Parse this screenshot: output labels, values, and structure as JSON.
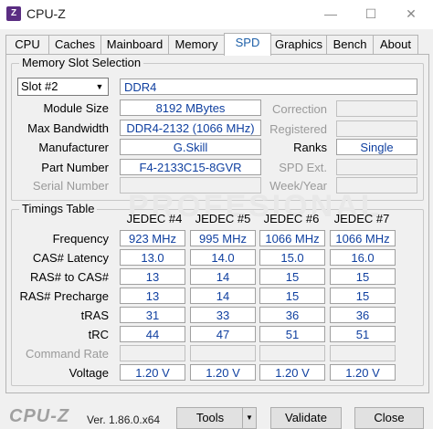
{
  "window": {
    "title": "CPU-Z",
    "minimize": "—",
    "maximize": "☐",
    "close": "✕"
  },
  "tabs": [
    "CPU",
    "Caches",
    "Mainboard",
    "Memory",
    "SPD",
    "Graphics",
    "Bench",
    "About"
  ],
  "active_tab": "SPD",
  "slot_section": {
    "title": "Memory Slot Selection",
    "slot_value": "Slot #2",
    "type": "DDR4",
    "left_fields": [
      {
        "label": "Module Size",
        "value": "8192 MBytes"
      },
      {
        "label": "Max Bandwidth",
        "value": "DDR4-2132 (1066 MHz)"
      },
      {
        "label": "Manufacturer",
        "value": "G.Skill"
      },
      {
        "label": "Part Number",
        "value": "F4-2133C15-8GVR"
      },
      {
        "label": "Serial Number",
        "value": ""
      }
    ],
    "right_fields": [
      {
        "label": "Correction",
        "value": ""
      },
      {
        "label": "Registered",
        "value": ""
      },
      {
        "label": "Ranks",
        "value": "Single"
      },
      {
        "label": "SPD Ext.",
        "value": ""
      },
      {
        "label": "Week/Year",
        "value": ""
      }
    ]
  },
  "timings": {
    "title": "Timings Table",
    "columns": [
      "JEDEC #4",
      "JEDEC #5",
      "JEDEC #6",
      "JEDEC #7"
    ],
    "rows": [
      {
        "label": "Frequency",
        "values": [
          "923 MHz",
          "995 MHz",
          "1066 MHz",
          "1066 MHz"
        ]
      },
      {
        "label": "CAS# Latency",
        "values": [
          "13.0",
          "14.0",
          "15.0",
          "16.0"
        ]
      },
      {
        "label": "RAS# to CAS#",
        "values": [
          "13",
          "14",
          "15",
          "15"
        ]
      },
      {
        "label": "RAS# Precharge",
        "values": [
          "13",
          "14",
          "15",
          "15"
        ]
      },
      {
        "label": "tRAS",
        "values": [
          "31",
          "33",
          "36",
          "36"
        ]
      },
      {
        "label": "tRC",
        "values": [
          "44",
          "47",
          "51",
          "51"
        ]
      },
      {
        "label": "Command Rate",
        "values": [
          "",
          "",
          "",
          ""
        ]
      },
      {
        "label": "Voltage",
        "values": [
          "1.20 V",
          "1.20 V",
          "1.20 V",
          "1.20 V"
        ]
      }
    ]
  },
  "footer": {
    "brand": "CPU-Z",
    "version": "Ver. 1.86.0.x64",
    "tools": "Tools",
    "validate": "Validate",
    "close": "Close"
  },
  "watermark": "PROFESIONAL"
}
